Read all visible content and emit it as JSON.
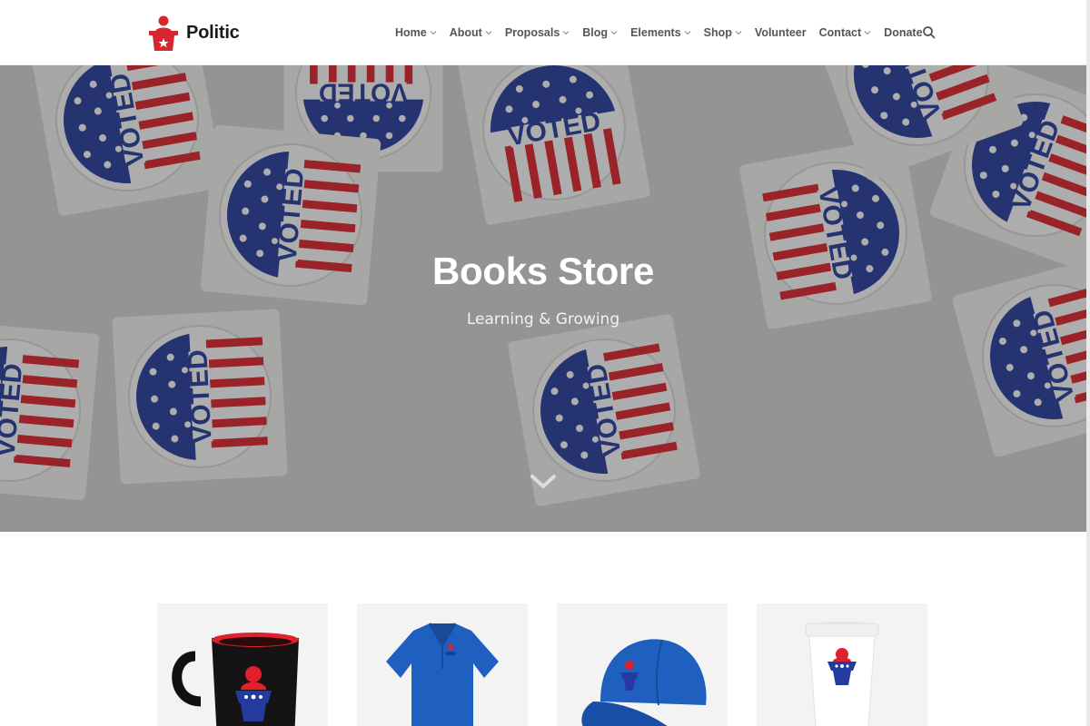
{
  "brand": {
    "name": "Politic",
    "logo_icon": "podium-logo-icon",
    "accent": "#d7262f"
  },
  "nav": {
    "items": [
      {
        "label": "Home",
        "has_dropdown": true
      },
      {
        "label": "About",
        "has_dropdown": true
      },
      {
        "label": "Proposals",
        "has_dropdown": true
      },
      {
        "label": "Blog",
        "has_dropdown": true
      },
      {
        "label": "Elements",
        "has_dropdown": true
      },
      {
        "label": "Shop",
        "has_dropdown": true
      },
      {
        "label": "Volunteer",
        "has_dropdown": false
      },
      {
        "label": "Contact",
        "has_dropdown": true
      },
      {
        "label": "Donate",
        "has_dropdown": false
      }
    ],
    "search_icon": "search-icon"
  },
  "hero": {
    "title": "Books Store",
    "subtitle": "Learning & Growing",
    "scroll_icon": "chevron-down-icon",
    "sticker_text": "I VOTED"
  },
  "products": [
    {
      "type": "mug",
      "icon": "mug-product"
    },
    {
      "type": "polo-shirt",
      "icon": "polo-shirt-product"
    },
    {
      "type": "cap",
      "icon": "cap-product"
    },
    {
      "type": "paper-cup",
      "icon": "paper-cup-product"
    }
  ],
  "colors": {
    "navy": "#243a9e",
    "red": "#e0202a",
    "shirt_blue": "#1f5fbf"
  }
}
